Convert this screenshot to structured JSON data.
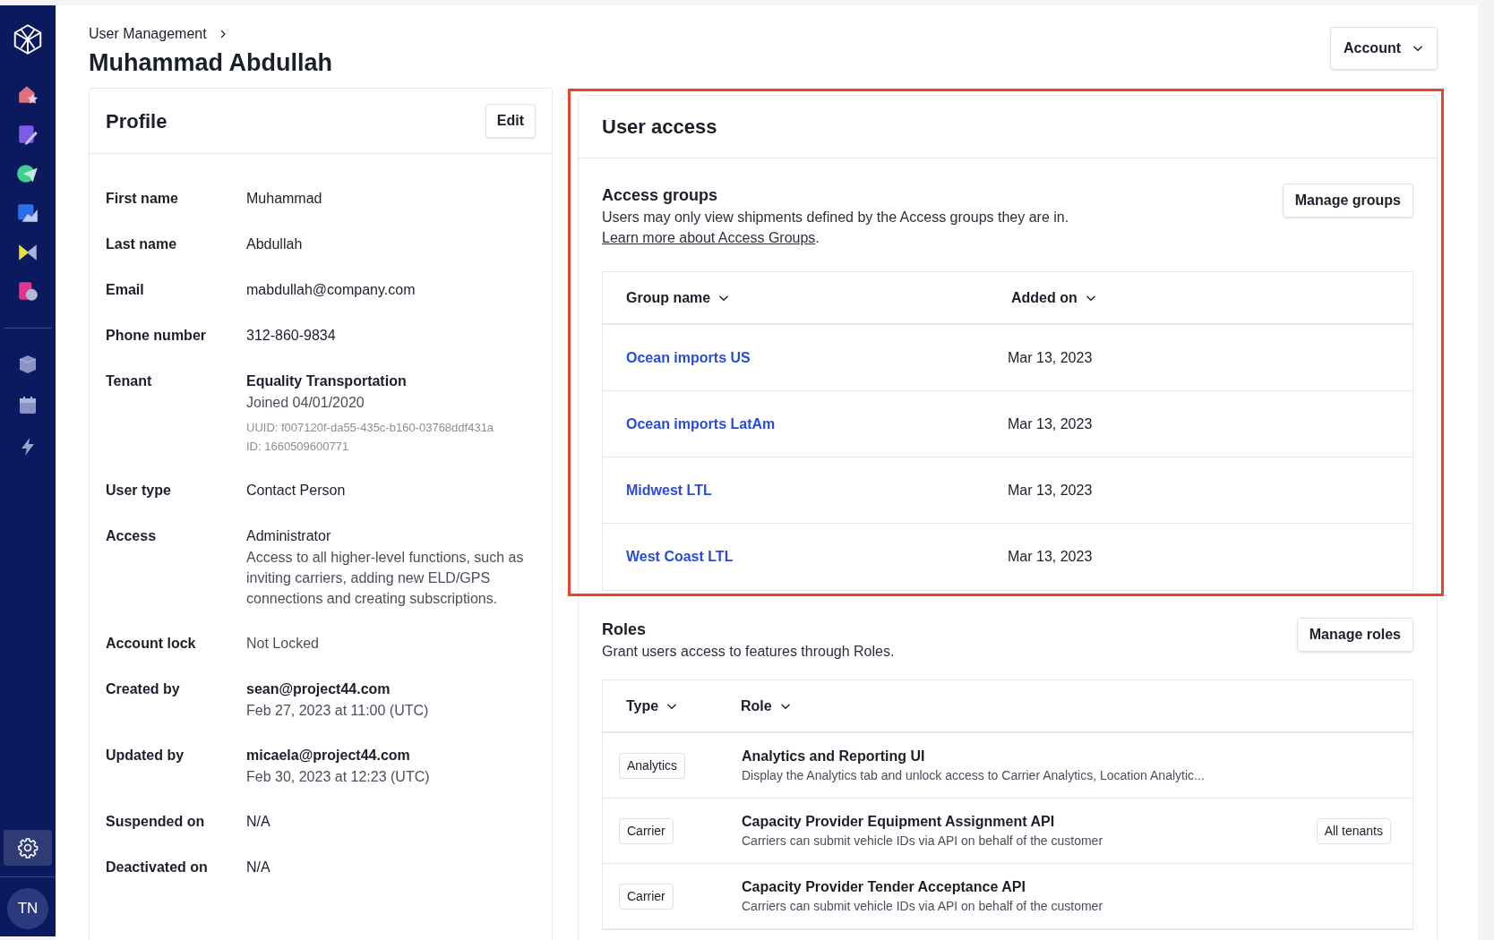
{
  "sidebar": {
    "apps": [
      {
        "selected": false
      },
      {
        "selected": false
      },
      {
        "selected": false
      },
      {
        "selected": false
      },
      {
        "selected": false
      },
      {
        "selected": false
      }
    ],
    "tools": [
      {
        "selected": false
      },
      {
        "selected": false
      },
      {
        "selected": false
      }
    ],
    "settings": {
      "selected": true
    },
    "avatar": "TN"
  },
  "breadcrumb": [
    "User Management"
  ],
  "title": "Muhammad Abdullah",
  "account_button": "Account",
  "profile": {
    "title": "Profile",
    "edit_button": "Edit",
    "fields": [
      {
        "label": "First name",
        "lines": [
          {
            "kind": "plain",
            "text": "Muhammad"
          }
        ]
      },
      {
        "label": "Last name",
        "lines": [
          {
            "kind": "plain",
            "text": "Abdullah"
          }
        ]
      },
      {
        "label": "Email",
        "lines": [
          {
            "kind": "plain",
            "text": "mabdullah@company.com"
          }
        ]
      },
      {
        "label": "Phone number",
        "lines": [
          {
            "kind": "plain",
            "text": "312-860-9834"
          }
        ]
      },
      {
        "label": "Tenant",
        "lines": [
          {
            "kind": "strong",
            "text": "Equality Transportation"
          },
          {
            "kind": "secondary",
            "text": "Joined 04/01/2020"
          },
          {
            "kind": "meta",
            "text": "UUID: f007120f-da55-435c-b160-03768ddf431a"
          },
          {
            "kind": "meta",
            "text": "ID: 1660509600771"
          }
        ]
      },
      {
        "label": "User type",
        "lines": [
          {
            "kind": "plain",
            "text": "Contact Person"
          }
        ]
      },
      {
        "label": "Access",
        "lines": [
          {
            "kind": "plain",
            "text": "Administrator"
          },
          {
            "kind": "secondary",
            "text": "Access to all higher-level functions, such as inviting carriers, adding new ELD/GPS connections and creating subscriptions."
          }
        ]
      },
      {
        "label": "Account lock",
        "lines": [
          {
            "kind": "secondary",
            "text": "Not Locked"
          }
        ]
      },
      {
        "label": "Created by",
        "lines": [
          {
            "kind": "strong",
            "text": "sean@project44.com"
          },
          {
            "kind": "secondary",
            "text": "Feb 27, 2023 at 11:00 (UTC)"
          }
        ]
      },
      {
        "label": "Updated by",
        "lines": [
          {
            "kind": "strong",
            "text": "micaela@project44.com"
          },
          {
            "kind": "secondary",
            "text": "Feb 30, 2023 at 12:23 (UTC)"
          }
        ]
      },
      {
        "label": "Suspended on",
        "lines": [
          {
            "kind": "plain",
            "text": "N/A"
          }
        ]
      },
      {
        "label": "Deactivated on",
        "lines": [
          {
            "kind": "plain",
            "text": "N/A"
          }
        ]
      }
    ]
  },
  "user_access": {
    "title": "User access",
    "access_groups": {
      "highlighted": true,
      "title": "Access groups",
      "description": "Users may only view shipments defined by the Access groups they are in.",
      "link": "Learn more about Access Groups",
      "link_suffix": ".",
      "button": "Manage groups",
      "columns": [
        "Group name",
        "Added on"
      ],
      "rows": [
        {
          "group_name": "Ocean imports US",
          "added_on": "Mar 13, 2023"
        },
        {
          "group_name": "Ocean imports LatAm",
          "added_on": "Mar 13, 2023"
        },
        {
          "group_name": "Midwest LTL",
          "added_on": "Mar 13, 2023"
        },
        {
          "group_name": "West Coast LTL",
          "added_on": "Mar 13, 2023"
        }
      ]
    },
    "roles": {
      "title": "Roles",
      "description": "Grant users access to features through Roles.",
      "button": "Manage roles",
      "columns": [
        "Type",
        "Role"
      ],
      "rows": [
        {
          "type": "Analytics",
          "role": "Analytics and Reporting UI",
          "description": "Display the Analytics tab and unlock access to Carrier Analytics, Location Analytic..."
        },
        {
          "type": "Carrier",
          "role": "Capacity Provider Equipment Assignment API",
          "description": "Carriers can submit vehicle IDs via API on behalf of the customer",
          "scope": "All tenants"
        },
        {
          "type": "Carrier",
          "role": "Capacity Provider Tender Acceptance API",
          "description": "Carriers can submit vehicle IDs via API on behalf of the customer"
        }
      ]
    }
  }
}
